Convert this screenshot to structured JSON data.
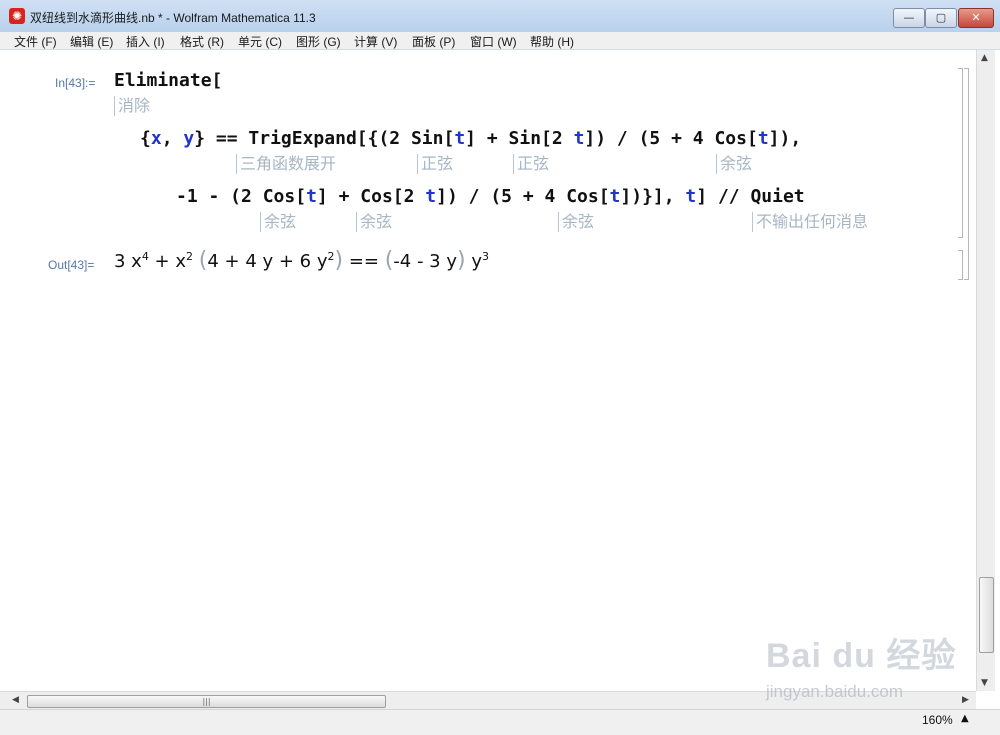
{
  "window": {
    "title": "双纽线到水滴形曲线.nb * - Wolfram Mathematica 11.3",
    "app_icon": "mathematica-icon",
    "controls": {
      "minimize": "—",
      "maximize": "▢",
      "close": "✕"
    }
  },
  "menu": [
    "文件 (F)",
    "编辑 (E)",
    "插入 (I)",
    "格式 (R)",
    "单元 (C)",
    "图形 (G)",
    "计算 (V)",
    "面板 (P)",
    "窗口 (W)",
    "帮助 (H)"
  ],
  "notebook": {
    "input_label": "In[43]:=",
    "output_label": "Out[43]=",
    "input": {
      "line1": {
        "fn": "Eliminate",
        "bracket": "["
      },
      "comment1": "消除",
      "line2": {
        "p1": "{",
        "x": "x",
        "p2": ", ",
        "y": "y",
        "p3": "} == ",
        "fn1": "TrigExpand",
        "p4": "[{(2 ",
        "fn2": "Sin",
        "p5": "[",
        "t1": "t",
        "p6": "] + ",
        "fn3": "Sin",
        "p7": "[2 ",
        "t2": "t",
        "p8": "]) / (5 + 4 ",
        "fn4": "Cos",
        "p9": "[",
        "t3": "t",
        "p10": "]),"
      },
      "comments2": [
        "三角函数展开",
        "正弦",
        "正弦",
        "余弦"
      ],
      "line3": {
        "p1": "-1 - (2 ",
        "fn1": "Cos",
        "p2": "[",
        "t1": "t",
        "p3": "] + ",
        "fn2": "Cos",
        "p4": "[2 ",
        "t2": "t",
        "p5": "]) / (5 + 4 ",
        "fn3": "Cos",
        "p6": "[",
        "t3": "t",
        "p7": "])}], ",
        "t4": "t",
        "p8": "] // ",
        "fn4": "Quiet"
      },
      "comments3": [
        "余弦",
        "余弦",
        "余弦",
        "不输出任何消息"
      ]
    },
    "output": {
      "a": "3 x",
      "a_exp": "4",
      "b": " + x",
      "b_exp": "2",
      "lp": "(",
      "c": "4 + 4 y + 6 y",
      "c_exp": "2",
      "rp": ")",
      "d": " == ",
      "lp2": "(",
      "e": "-4 - 3 y",
      "rp2": ")",
      "f": " y",
      "f_exp": "3"
    }
  },
  "status": {
    "zoom": "160%",
    "zoom_arrow": "▲"
  },
  "watermark": {
    "logo": "Bai du 经验",
    "sub": "jingyan.baidu.com"
  }
}
